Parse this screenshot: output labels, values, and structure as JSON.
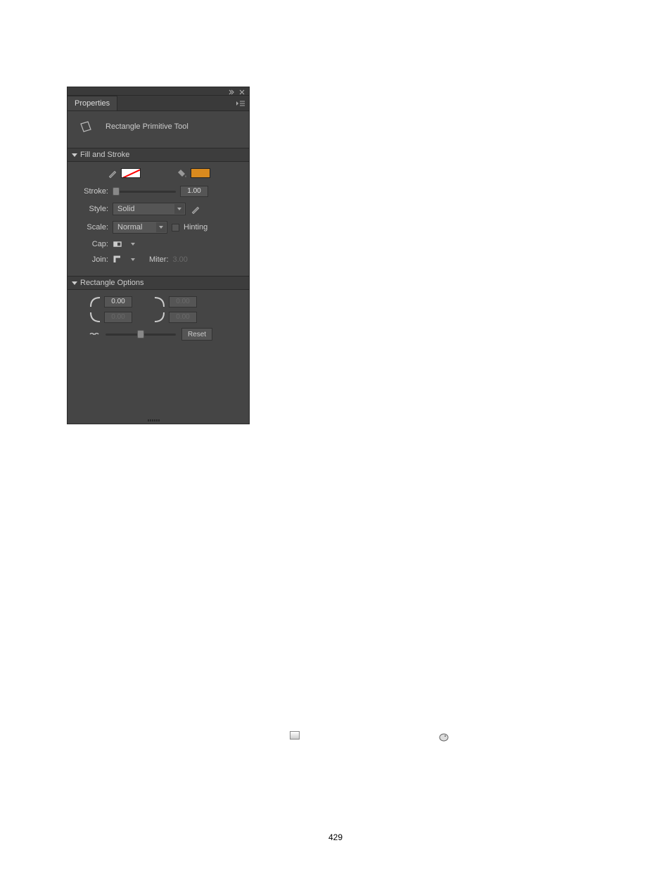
{
  "panel": {
    "tab": "Properties",
    "tool": "Rectangle Primitive Tool"
  },
  "fillStroke": {
    "header": "Fill and Stroke",
    "strokeLabel": "Stroke:",
    "strokeValue": "1.00",
    "styleLabel": "Style:",
    "styleValue": "Solid",
    "scaleLabel": "Scale:",
    "scaleValue": "Normal",
    "hintingLabel": "Hinting",
    "capLabel": "Cap:",
    "joinLabel": "Join:",
    "miterLabel": "Miter:",
    "miterValue": "3.00"
  },
  "rectOptions": {
    "header": "Rectangle Options",
    "tl": "0.00",
    "tr": "0.00",
    "bl": "0.00",
    "br": "0.00",
    "reset": "Reset"
  },
  "pageNumber": "429"
}
